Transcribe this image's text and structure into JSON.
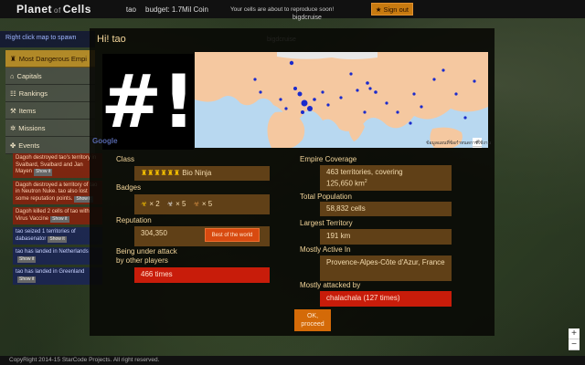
{
  "header": {
    "logo_main": "Planet",
    "logo_of": "of",
    "logo_end": "Cells",
    "user": "tao",
    "budget": "budget: 1.7Mil Coin",
    "message": "Your cells are about to reproduce soon!",
    "signout_label": "Sign out",
    "caption": "bigdcruise"
  },
  "map_caption": "bigdcruise",
  "hint": "Right click map to spawn",
  "sidebar": {
    "items": [
      {
        "icon": "♜",
        "label": "Most Dangerous Empi"
      },
      {
        "icon": "⌂",
        "label": "Capitals"
      },
      {
        "icon": "☷",
        "label": "Rankings"
      },
      {
        "icon": "⚒",
        "label": "Items"
      },
      {
        "icon": "✲",
        "label": "Missions"
      },
      {
        "icon": "✤",
        "label": "Events"
      }
    ]
  },
  "events": [
    {
      "text": "Dagoh destroyed tao's territory in Svalbard, Svalbard and Jan Mayen",
      "btn": "Show it"
    },
    {
      "text": "Dagoh destroyed a territory of tao in Neutron Nuke. tao also lost some reputation points.",
      "btn": "Show it"
    },
    {
      "text": "Dagoh killed 2 cells of tao with Virus Vaccine",
      "btn": "Show it"
    },
    {
      "text": "tao seized 1 territories of dabasenator",
      "btn": "Show it"
    },
    {
      "text": "tao has landed in Netherlands",
      "btn": "Show it"
    },
    {
      "text": "tao has landed in Greenland",
      "btn": "Show it"
    }
  ],
  "footer": "CopyRight 2014-15 StarCode Projects. All right reserved.",
  "modal": {
    "title": "Hi! tao",
    "avatar_text": "#!",
    "map_google": "Google",
    "map_terms": "ข้อมูลแผนที่ข้อกำหนดการใช้งาน",
    "class_label": "Class",
    "class_stars": "♜♜♜♜♜♜",
    "class_value": "Bio Ninja",
    "badges_label": "Badges",
    "badges": [
      {
        "icon": "☣",
        "count": "× 2"
      },
      {
        "icon": "☣",
        "count": "× 5"
      },
      {
        "icon": "☣",
        "count": "× 5"
      }
    ],
    "reputation_label": "Reputation",
    "reputation_value": "304,350",
    "best_label": "Best of the world",
    "attack_label_1": "Being under attack",
    "attack_label_2": "by other players",
    "attack_value": "466 times",
    "coverage_label": "Empire Coverage",
    "coverage_line1": "463 territories, covering",
    "coverage_line2": "125,650 km",
    "coverage_sup": "2",
    "population_label": "Total Population",
    "population_value": "58,832 cells",
    "largest_label": "Largest Territory",
    "largest_value": "191 km",
    "active_label": "Mostly Active In",
    "active_value": "Provence-Alpes-Côte d'Azur, France",
    "attacked_by_label": "Mostly attacked by",
    "attacked_by_value": "chalachala (127 times)",
    "ok_line1": "OK,",
    "ok_line2": "proceed"
  },
  "colors": {
    "accent": "#c87a10",
    "field": "#69461a",
    "danger": "#c81c0a",
    "land": "#f5c8a0",
    "sea": "#b8d8f0",
    "dot": "#1a2acc"
  }
}
